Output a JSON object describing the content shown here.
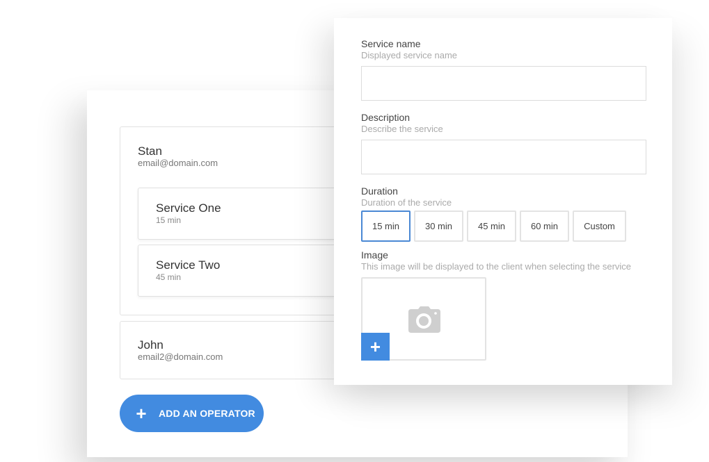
{
  "operators": [
    {
      "name": "Stan",
      "email": "email@domain.com",
      "services": [
        {
          "name": "Service One",
          "duration": "15 min"
        },
        {
          "name": "Service Two",
          "duration": "45 min"
        }
      ]
    },
    {
      "name": "John",
      "email": "email2@domain.com",
      "services": []
    }
  ],
  "add_operator": {
    "icon": "plus-icon",
    "label": "ADD AN OPERATOR"
  },
  "service_form": {
    "service_name": {
      "label": "Service name",
      "hint": "Displayed service name",
      "value": "",
      "placeholder": ""
    },
    "description": {
      "label": "Description",
      "hint": "Describe the service",
      "value": "",
      "placeholder": ""
    },
    "duration": {
      "label": "Duration",
      "hint": "Duration of the service",
      "options": [
        "15 min",
        "30 min",
        "45 min",
        "60 min",
        "Custom"
      ],
      "selected": "15 min"
    },
    "image": {
      "label": "Image",
      "hint": "This image will be displayed to the client when selecting the service",
      "placeholder_icon": "camera-icon",
      "add_icon": "plus-icon",
      "add_label": "+"
    }
  },
  "colors": {
    "accent": "#428be0",
    "selected_border": "#4a88d4",
    "border": "#e3e3e3",
    "hint_text": "#aaaaaa"
  }
}
